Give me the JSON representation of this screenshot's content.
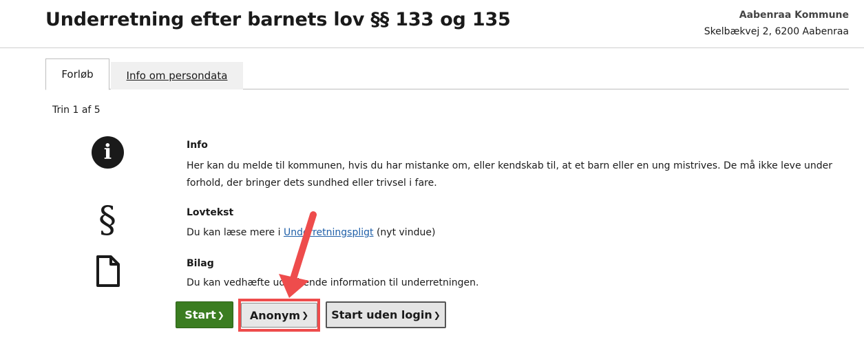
{
  "header": {
    "title": "Underretning efter barnets lov §§ 133 og 135",
    "org_name": "Aabenraa Kommune",
    "org_address": "Skelbækvej 2, 6200 Aabenraa"
  },
  "tabs": [
    {
      "label": "Forløb"
    },
    {
      "label": "Info om persondata"
    }
  ],
  "step": "Trin 1 af 5",
  "sections": [
    {
      "icon": "info-icon",
      "title": "Info",
      "text": "Her kan du melde til kommunen, hvis du har mistanke om, eller kendskab til, at et barn eller en ung mistrives. De må ikke leve under forhold, der bringer dets sundhed eller trivsel i fare."
    },
    {
      "icon": "paragraph-icon",
      "title": "Lovtekst",
      "text_before": "Du kan læse mere i ",
      "link": "Underretningspligt",
      "text_after": " (nyt vindue)"
    },
    {
      "icon": "file-icon",
      "title": "Bilag",
      "text": "Du kan vedhæfte uddybende information til underretningen."
    }
  ],
  "buttons": {
    "start": "Start",
    "anonym": "Anonym",
    "no_login": "Start uden login"
  },
  "chevron": "❯",
  "colors": {
    "start_green": "#3b7d21",
    "highlight_red": "#ee4c4c",
    "link_blue": "#1f5fa8"
  }
}
